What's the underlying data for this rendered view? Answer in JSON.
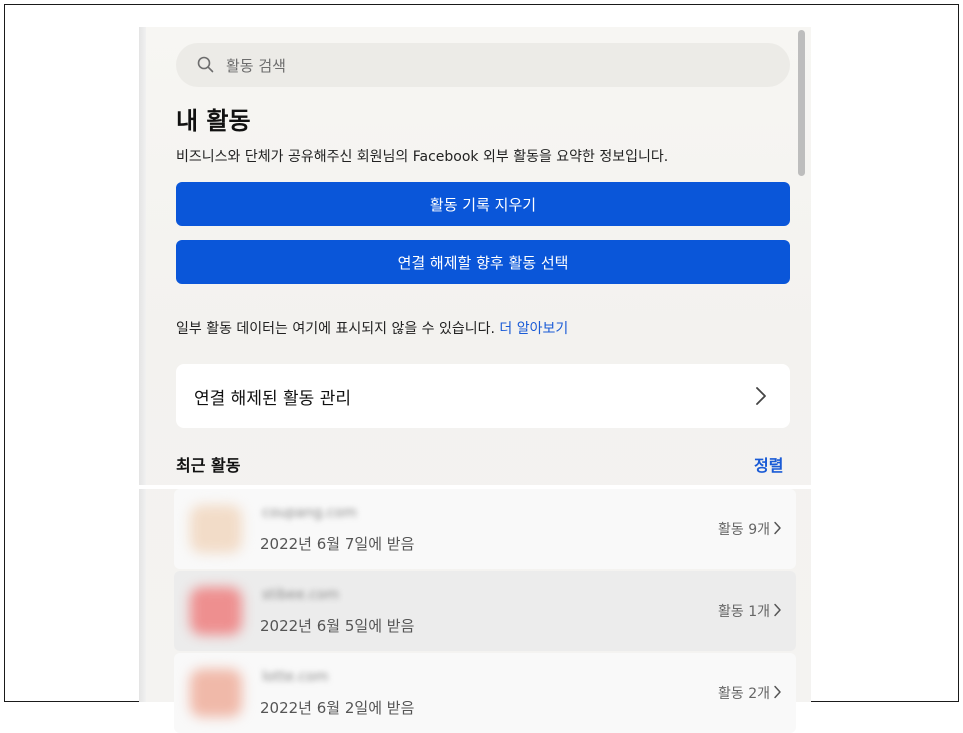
{
  "search": {
    "icon": "search-icon",
    "placeholder": "활동 검색"
  },
  "header": {
    "title": "내 활동",
    "subtitle": "비즈니스와 단체가 공유해주신 회원님의 Facebook 외부 활동을 요약한 정보입니다."
  },
  "actions": {
    "clear_history": "활동 기록 지우기",
    "disconnect_future": "연결 해제할 향후 활동 선택"
  },
  "notice": {
    "text": "일부 활동 데이터는 여기에 표시되지 않을 수 있습니다.",
    "link": "더 알아보기"
  },
  "manage": {
    "label": "연결 해제된 활동 관리",
    "icon": "chevron-right-icon"
  },
  "recent": {
    "title": "최근 활동",
    "sort_label": "정렬"
  },
  "colors": {
    "primary": "#0a56d9",
    "link": "#1a5bd6",
    "background": "#f4f3f1"
  },
  "activities": [
    {
      "domain": "coupang.com",
      "received": "2022년 6월 7일에 받음",
      "count": "활동 9개",
      "thumb_color": "#f2dcc8"
    },
    {
      "domain": "stibee.com",
      "received": "2022년 6월 5일에 받음",
      "count": "활동 1개",
      "thumb_color": "#ee8f8f"
    },
    {
      "domain": "lotte.com",
      "received": "2022년 6월 2일에 받음",
      "count": "활동 2개",
      "thumb_color": "#f0b9a9"
    }
  ]
}
